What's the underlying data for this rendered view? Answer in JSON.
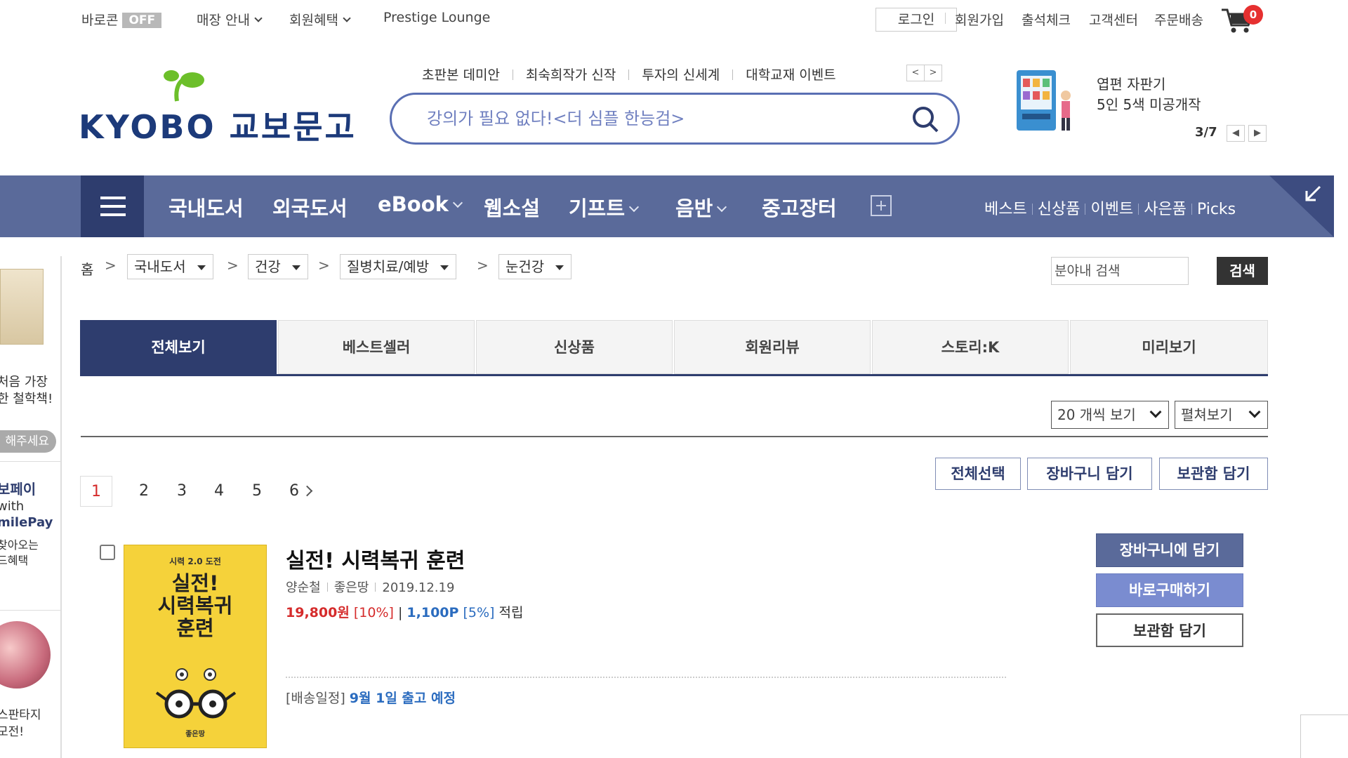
{
  "util": {
    "barocon": "바로콘",
    "off": "OFF",
    "store_info": "매장 안내",
    "benefits": "회원혜택",
    "prestige": "Prestige Lounge",
    "login": "로그인",
    "join": "회원가입",
    "attendance": "출석체크",
    "customer_center": "고객센터",
    "order_delivery": "주문배송",
    "cart_count": "0"
  },
  "logo": {
    "text": "KYOBO 교보문고"
  },
  "header_links": [
    "초판본 데미안",
    "최숙희작가 신작",
    "투자의 신세계",
    "대학교재 이벤트"
  ],
  "search": {
    "placeholder": "강의가 필요 없다!<더 심플 한능검>"
  },
  "promo": {
    "line1": "엽편 자판기",
    "line2": "5인 5색 미공개작",
    "page": "3/7"
  },
  "nav": {
    "categories": [
      "국내도서",
      "외국도서",
      "eBook",
      "웹소설",
      "기프트",
      "음반",
      "중고장터"
    ],
    "right_links": [
      "베스트",
      "신상품",
      "이벤트",
      "사은품",
      "Picks"
    ]
  },
  "side": {
    "text1a": "처음 가장",
    "text1b": "한 철학책!",
    "pill": "해주세요",
    "pay1": "보페이",
    "pay2": "with",
    "pay3": "milePay",
    "pay4": "찾아오는",
    "pay5": "드혜택",
    "t3a": "스판타지",
    "t3b": "모전!"
  },
  "breadcrumb": {
    "home": "홈",
    "levels": [
      "국내도서",
      "건강",
      "질병치료/예방",
      "눈건강"
    ]
  },
  "inner_search": {
    "placeholder": "분야내 검색",
    "button": "검색"
  },
  "tabs": [
    "전체보기",
    "베스트셀러",
    "신상품",
    "회원리뷰",
    "스토리:K",
    "미리보기"
  ],
  "view": {
    "per_page": "20 개씩 보기",
    "mode": "펼쳐보기"
  },
  "actions": [
    "전체선택",
    "장바구니 담기",
    "보관함 담기"
  ],
  "pager": {
    "pages": [
      "1",
      "2",
      "3",
      "4",
      "5",
      "6"
    ],
    "current": "1"
  },
  "product": {
    "cover_top": "시력 2.0 도전",
    "cover_title": "실전! 시력복귀 훈련",
    "title": "실전! 시력복귀 훈련",
    "author": "양순철",
    "publisher": "좋은땅",
    "date": "2019.12.19",
    "price": "19,800원",
    "discount": "[10%]",
    "sep": "|",
    "points": "1,100P",
    "point_rate": "[5%]",
    "accrue": "적립",
    "ship_label": "[배송일정]",
    "ship_value": "9월 1일 출고 예정",
    "btn_cart": "장바구니에 담기",
    "btn_buy": "바로구매하기",
    "btn_keep": "보관함 담기"
  },
  "colors": {
    "brand": "#2e3d6e",
    "nav": "#5a6a9a",
    "price": "#d52b2b",
    "point": "#2b6cbf"
  }
}
